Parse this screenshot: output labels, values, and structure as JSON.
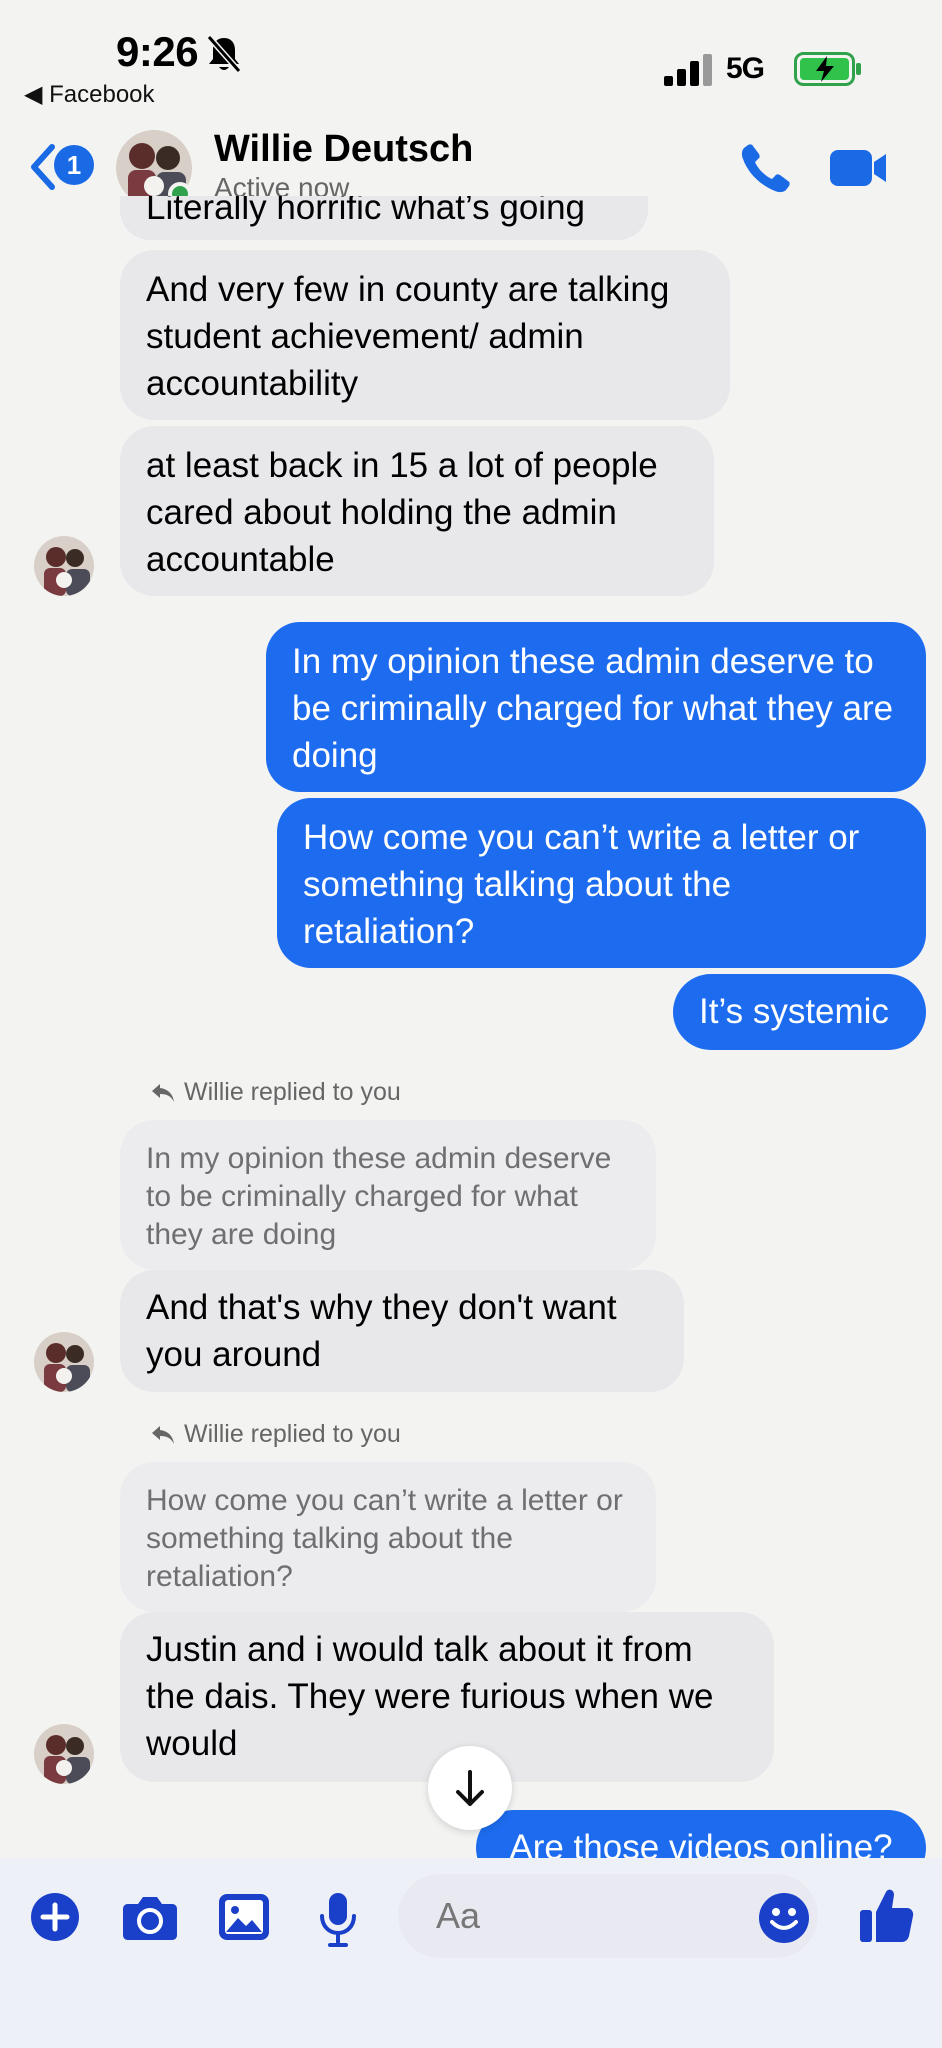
{
  "status_bar": {
    "time": "9:26",
    "back_app": "◀ Facebook",
    "network": "5G"
  },
  "header": {
    "unread_count": "1",
    "name": "Willie Deutsch",
    "status": "Active now"
  },
  "colors": {
    "accent": "#1d6cef",
    "incoming": "#e8e8eb",
    "online": "#31a24c",
    "icon_blue": "#1a3fc9"
  },
  "messages": [
    {
      "from": "them",
      "text": "Literally horrific what’s going on."
    },
    {
      "from": "them",
      "text": "And very few in county are talking student achievement/ admin accountability"
    },
    {
      "from": "them",
      "text": "at least back in 15 a lot of people cared about holding the admin accountable"
    },
    {
      "from": "me",
      "text": "In my opinion these admin deserve to be criminally charged for what they are doing"
    },
    {
      "from": "me",
      "text": "How come you can’t write a letter or something talking about the retaliation?"
    },
    {
      "from": "me",
      "text": "It’s systemic"
    },
    {
      "from": "them",
      "reply_label": "Willie replied to you",
      "quoted": "In my opinion these admin deserve to be criminally charged for what they are doing",
      "text": "And that's why they don't want you around"
    },
    {
      "from": "them",
      "reply_label": "Willie replied to you",
      "quoted": "How come you can’t write a letter or something talking about the retaliation?",
      "text": "Justin and i would talk about it from the dais. They were furious when we would"
    },
    {
      "from": "me",
      "text": "Are those videos online?"
    }
  ],
  "composer": {
    "placeholder": "Aa"
  },
  "icons": [
    "bell-slash-icon",
    "signal-icon",
    "battery-charging-icon",
    "back-chevron-icon",
    "phone-icon",
    "video-icon",
    "arrow-down-icon",
    "plus-icon",
    "camera-icon",
    "gallery-icon",
    "mic-icon",
    "emoji-icon",
    "thumbs-up-icon"
  ]
}
